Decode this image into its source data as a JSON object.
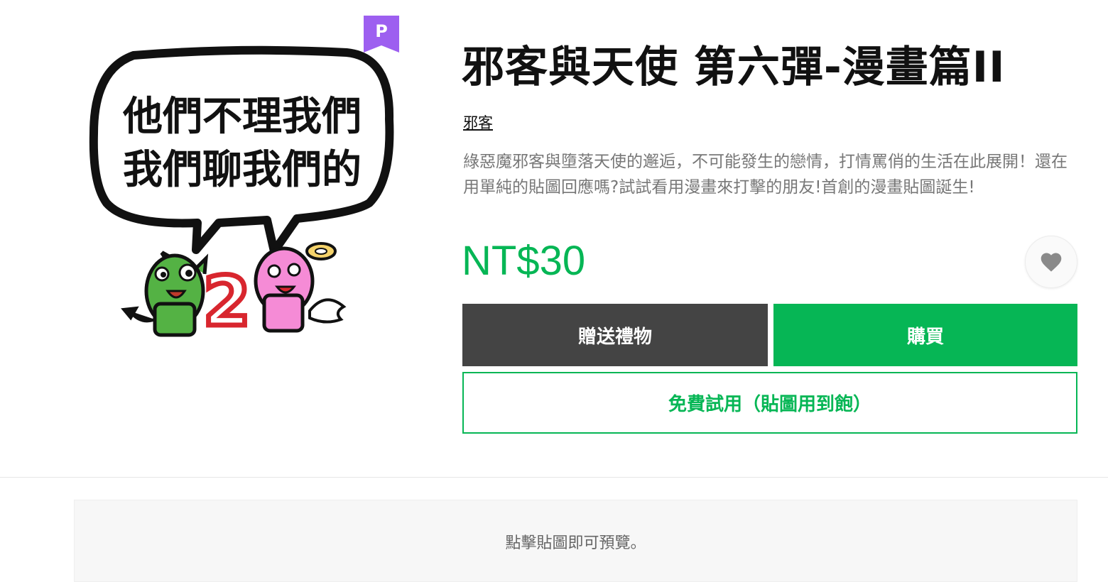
{
  "product": {
    "premium_badge": "P",
    "sticker_lines": [
      "他們不理我們",
      "我們聊我們的"
    ],
    "sticker_number": "2",
    "title": "邪客與天使 第六彈-漫畫篇II",
    "author": "邪客",
    "description": "綠惡魔邪客與墮落天使的邂逅，不可能發生的戀情，打情罵俏的生活在此展開！還在用單純的貼圖回應嗎?試試看用漫畫來打擊的朋友!首創的漫畫貼圖誕生!",
    "price": "NT$30"
  },
  "actions": {
    "gift_label": "贈送禮物",
    "buy_label": "購買",
    "trial_label": "免費試用（貼圖用到飽）",
    "favorite_icon": "heart-icon"
  },
  "preview": {
    "hint": "點擊貼圖即可預覽。"
  },
  "colors": {
    "brand_green": "#06b655",
    "gift_button": "#444444",
    "premium_purple": "#9d5ff0",
    "sticker_devil": "#54b244",
    "sticker_angel": "#f58bd6",
    "sticker_number": "#d8262e"
  }
}
